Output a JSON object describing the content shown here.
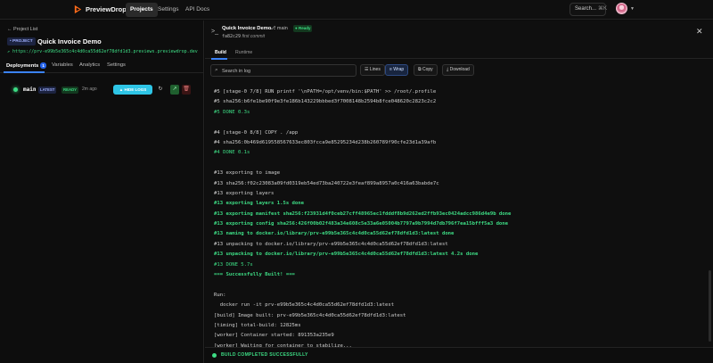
{
  "nav": {
    "brand": "PreviewDrop",
    "tabs": [
      "Projects",
      "Settings",
      "API Docs"
    ],
    "search_label": "Search...",
    "search_shortcut": "⌘K"
  },
  "project": {
    "back_label": "← Project List",
    "badge": "• PROJECT",
    "name": "Quick Invoice Demo",
    "url": "↗ https://prv-e99b5e365c4c4d0ca55d62ef78dfd1d3.previews.previewdrop.dev",
    "tabs": [
      "Deployments",
      "Variables",
      "Analytics",
      "Settings"
    ],
    "deployments_count": "1"
  },
  "deployment": {
    "branch": "main",
    "latest_badge": "LATEST",
    "status_badge": "READY",
    "age": "2m ago",
    "hide_logs_label": "▲ HIDE LOGS"
  },
  "log_panel": {
    "title": "Quick Invoice Demo",
    "branch": "⎇ main",
    "status": "● Ready",
    "commit_hash": "fa82c29",
    "commit_message": "first commit",
    "tabs": [
      "Build",
      "Runtime"
    ],
    "search_placeholder": "Search in log",
    "buttons": {
      "lines": "☰ Lines",
      "wrap": "≡ Wrap",
      "copy": "⧉ Copy",
      "download": "⤓ Download"
    },
    "footer_status": "BUILD COMPLETED SUCCESSFULLY"
  },
  "log_lines": [
    {
      "text": "#5 [stage-0 7/8] RUN printf '\\nPATH=/opt/venv/bin:$PATH' >> /root/.profile",
      "style": "normal"
    },
    {
      "text": "#5 sha256:b6fe1be90f9e3fe186b143229bbbed3f7008148b2594b8fce048620c2823c2c2",
      "style": "normal"
    },
    {
      "text": "#5 DONE 0.3s",
      "style": "green"
    },
    {
      "text": "",
      "style": "normal"
    },
    {
      "text": "#4 [stage-0 8/8] COPY . /app",
      "style": "normal"
    },
    {
      "text": "#4 sha256:0b469d619558567633ec803fcca9e85295234d238b260789f90cfe23d1a39afb",
      "style": "normal"
    },
    {
      "text": "#4 DONE 0.1s",
      "style": "green"
    },
    {
      "text": "",
      "style": "normal"
    },
    {
      "text": "#13 exporting to image",
      "style": "normal"
    },
    {
      "text": "#13 sha256:f02c23083a09fd0319eb54ed73ba240722e3feaf899a8957a0c416a63babde7c",
      "style": "normal"
    },
    {
      "text": "#13 exporting layers",
      "style": "normal"
    },
    {
      "text": "#13 exporting layers 1.5s done",
      "style": "bgreen"
    },
    {
      "text": "#13 exporting manifest sha256:f23931d4f0ceb27cff48965ec1fdddf8b9d262ed2ffb93ec0424adcc986d4e9b done",
      "style": "bgreen"
    },
    {
      "text": "#13 exporting config sha256:426f00b02f483a34e608c5e33a6e05004b7797a9b7994d7db796f7ea15bfff5a3 done",
      "style": "bgreen"
    },
    {
      "text": "#13 naming to docker.io/library/prv-e99b5e365c4c4d0ca55d62ef78dfd1d3:latest done",
      "style": "bgreen"
    },
    {
      "text": "#13 unpacking to docker.io/library/prv-e99b5e365c4c4d0ca55d62ef78dfd1d3:latest",
      "style": "normal"
    },
    {
      "text": "#13 unpacking to docker.io/library/prv-e99b5e365c4c4d0ca55d62ef78dfd1d3:latest 4.2s done",
      "style": "bgreen"
    },
    {
      "text": "#13 DONE 5.7s",
      "style": "green"
    },
    {
      "text": "=== Successfully Built! ===",
      "style": "bgreen"
    },
    {
      "text": "",
      "style": "normal"
    },
    {
      "text": "Run:",
      "style": "normal"
    },
    {
      "text": "  docker run -it prv-e99b5e365c4c4d0ca55d62ef78dfd1d3:latest",
      "style": "normal"
    },
    {
      "text": "[build] Image built: prv-e99b5e365c4c4d0ca55d62ef78dfd1d3:latest",
      "style": "normal"
    },
    {
      "text": "[timing] total-build: 12825ms",
      "style": "normal"
    },
    {
      "text": "[worker] Container started: 891353a235e9",
      "style": "normal"
    },
    {
      "text": "[worker] Waiting for container to stabilize...",
      "style": "normal"
    }
  ],
  "colors": {
    "accent_green": "#3ddc84",
    "accent_blue": "#3b82f6",
    "hide_logs_button": "#2ec5e6"
  }
}
